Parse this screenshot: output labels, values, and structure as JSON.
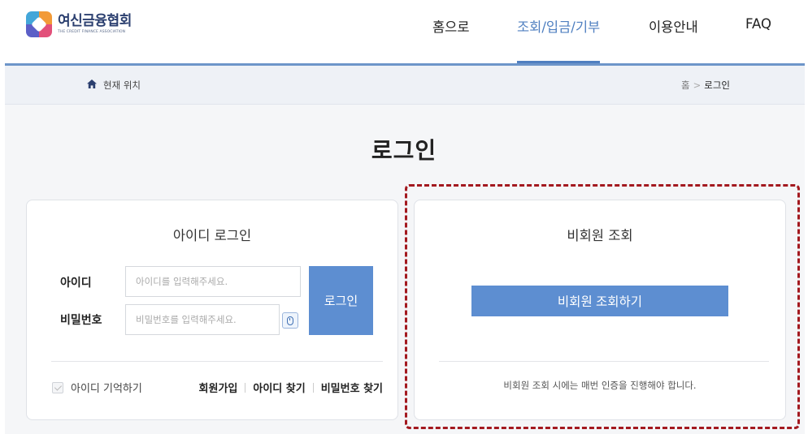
{
  "header": {
    "logo": {
      "ko": "여신금융협회",
      "en": "THE CREDIT FINANCE ASSOCIATION"
    },
    "nav": [
      {
        "label": "홈으로"
      },
      {
        "label": "조회/입금/기부"
      },
      {
        "label": "이용안내"
      },
      {
        "label": "FAQ"
      }
    ],
    "active_color": "#4f7fc0"
  },
  "breadcrumb": {
    "label": "현재 위치",
    "path": [
      "홈",
      "로그인"
    ],
    "separator": ">"
  },
  "page": {
    "title": "로그인"
  },
  "id_login": {
    "title": "아이디 로그인",
    "id_label": "아이디",
    "id_placeholder": "아이디를 입력해주세요.",
    "pw_label": "비밀번호",
    "pw_placeholder": "비밀번호를 입력해주세요.",
    "login_button": "로그인",
    "remember_label": "아이디 기억하기",
    "links": [
      "회원가입",
      "아이디 찾기",
      "비밀번호 찾기"
    ]
  },
  "guest": {
    "title": "비회원 조회",
    "button": "비회원 조회하기",
    "notice": "비회원 조회 시에는 매번 인증을 진행해야 합니다."
  },
  "colors": {
    "primary_button": "#5d8ed1",
    "highlight_border": "#a3191f"
  }
}
